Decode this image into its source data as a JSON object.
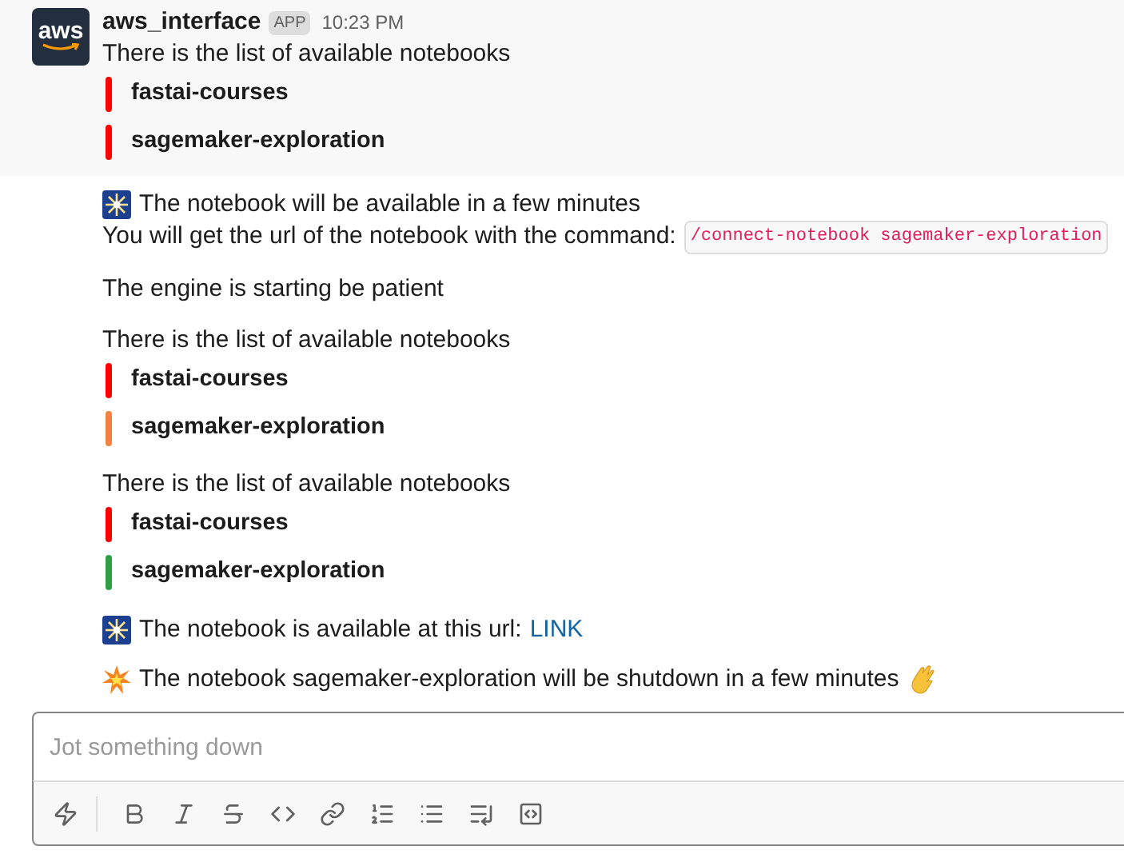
{
  "header": {
    "app_name": "aws_interface",
    "badge": "APP",
    "time": "10:23 PM",
    "logo": "aws"
  },
  "messages": [
    {
      "kind": "list",
      "title": "There is the list of available notebooks",
      "items": [
        {
          "name": "fastai-courses",
          "color": "#ff0000"
        },
        {
          "name": "sagemaker-exploration",
          "color": "#ff0000"
        }
      ]
    },
    {
      "kind": "announce",
      "text": "The notebook will be available in a few minutes"
    },
    {
      "kind": "command",
      "text": "You will get the url of the notebook with the command:",
      "code": "/connect-notebook sagemaker-exploration"
    },
    {
      "kind": "plain",
      "text": "The engine is starting be patient"
    },
    {
      "kind": "list",
      "title": "There is the list of available notebooks",
      "items": [
        {
          "name": "fastai-courses",
          "color": "#ff0000"
        },
        {
          "name": "sagemaker-exploration",
          "color": "#f5813f"
        }
      ]
    },
    {
      "kind": "list",
      "title": "There is the list of available notebooks",
      "items": [
        {
          "name": "fastai-courses",
          "color": "#ff0000"
        },
        {
          "name": "sagemaker-exploration",
          "color": "#2ea043"
        }
      ]
    },
    {
      "kind": "link",
      "text": "The notebook is available at this url:",
      "link": "LINK"
    },
    {
      "kind": "alert",
      "text": "The notebook sagemaker-exploration will be shutdown in a few minutes"
    }
  ],
  "composer": {
    "placeholder": "Jot something down"
  }
}
